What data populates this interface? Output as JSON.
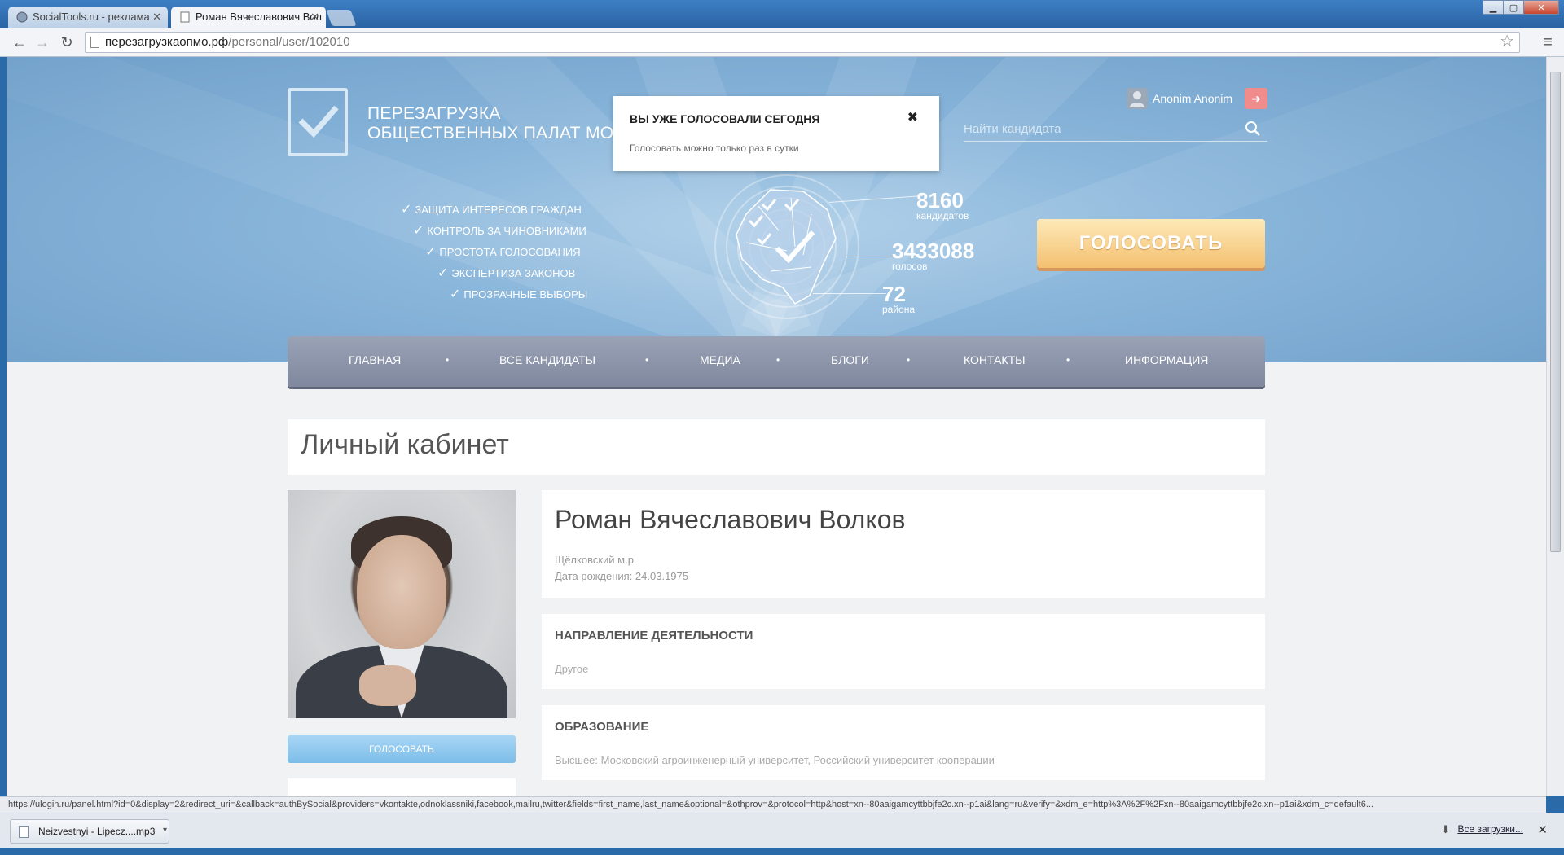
{
  "browser": {
    "tabs": [
      {
        "label": "SocialTools.ru - реклама",
        "active": false
      },
      {
        "label": "Роман Вячеславович Вол",
        "active": true
      }
    ],
    "url_host": "перезагрузкаопмо.рф",
    "url_path": "/personal/user/102010",
    "status_url": "https://ulogin.ru/panel.html?id=0&display=2&redirect_uri=&callback=authBySocial&providers=vkontakte,odnoklassniki,facebook,mailru,twitter&fields=first_name,last_name&optional=&othprov=&protocol=http&host=xn--80aaigamcyttbbjfe2c.xn--p1ai&lang=ru&verify=&xdm_e=http%3A%2F%2Fxn--80aaigamcyttbbjfe2c.xn--p1ai&xdm_c=default6...",
    "download": {
      "file": "Neizvestnyi - Lipecz....mp3",
      "all_label": "Все загрузки..."
    }
  },
  "site": {
    "logo_line1": "ПЕРЕЗАГРУЗКА",
    "logo_line2": "ОБЩЕСТВЕННЫХ ПАЛАТ МО",
    "features": [
      "ЗАЩИТА ИНТЕРЕСОВ ГРАЖДАН",
      "КОНТРОЛЬ ЗА ЧИНОВНИКАМИ",
      "ПРОСТОТА ГОЛОСОВАНИЯ",
      "ЭКСПЕРТИЗА ЗАКОНОВ",
      "ПРОЗРАЧНЫЕ ВЫБОРЫ"
    ],
    "stats": [
      {
        "value": "8160",
        "label": "кандидатов"
      },
      {
        "value": "3433088",
        "label": "голосов"
      },
      {
        "value": "72",
        "label": "района"
      }
    ],
    "vote_button": "ГОЛОСОВАТЬ",
    "user_name": "Anonim Anonim",
    "search_placeholder": "Найти кандидата",
    "popup": {
      "title": "ВЫ УЖЕ ГОЛОСОВАЛИ СЕГОДНЯ",
      "text": "Голосовать можно только раз в сутки"
    },
    "nav": [
      "ГЛАВНАЯ",
      "ВСЕ КАНДИДАТЫ",
      "МЕДИА",
      "БЛОГИ",
      "КОНТАКТЫ",
      "ИНФОРМАЦИЯ"
    ]
  },
  "profile": {
    "page_title": "Личный кабинет",
    "name": "Роман Вячеславович Волков",
    "district": "Щёлковский м.р.",
    "birth": "Дата рождения: 24.03.1975",
    "activity_title": "НАПРАВЛЕНИЕ ДЕЯТЕЛЬНОСТИ",
    "activity_value": "Другое",
    "education_title": "ОБРАЗОВАНИЕ",
    "education_value": "Высшее: Московский агроинженерный университет, Российский университет кооперации",
    "vote_label": "ГОЛОСОВАТЬ"
  }
}
